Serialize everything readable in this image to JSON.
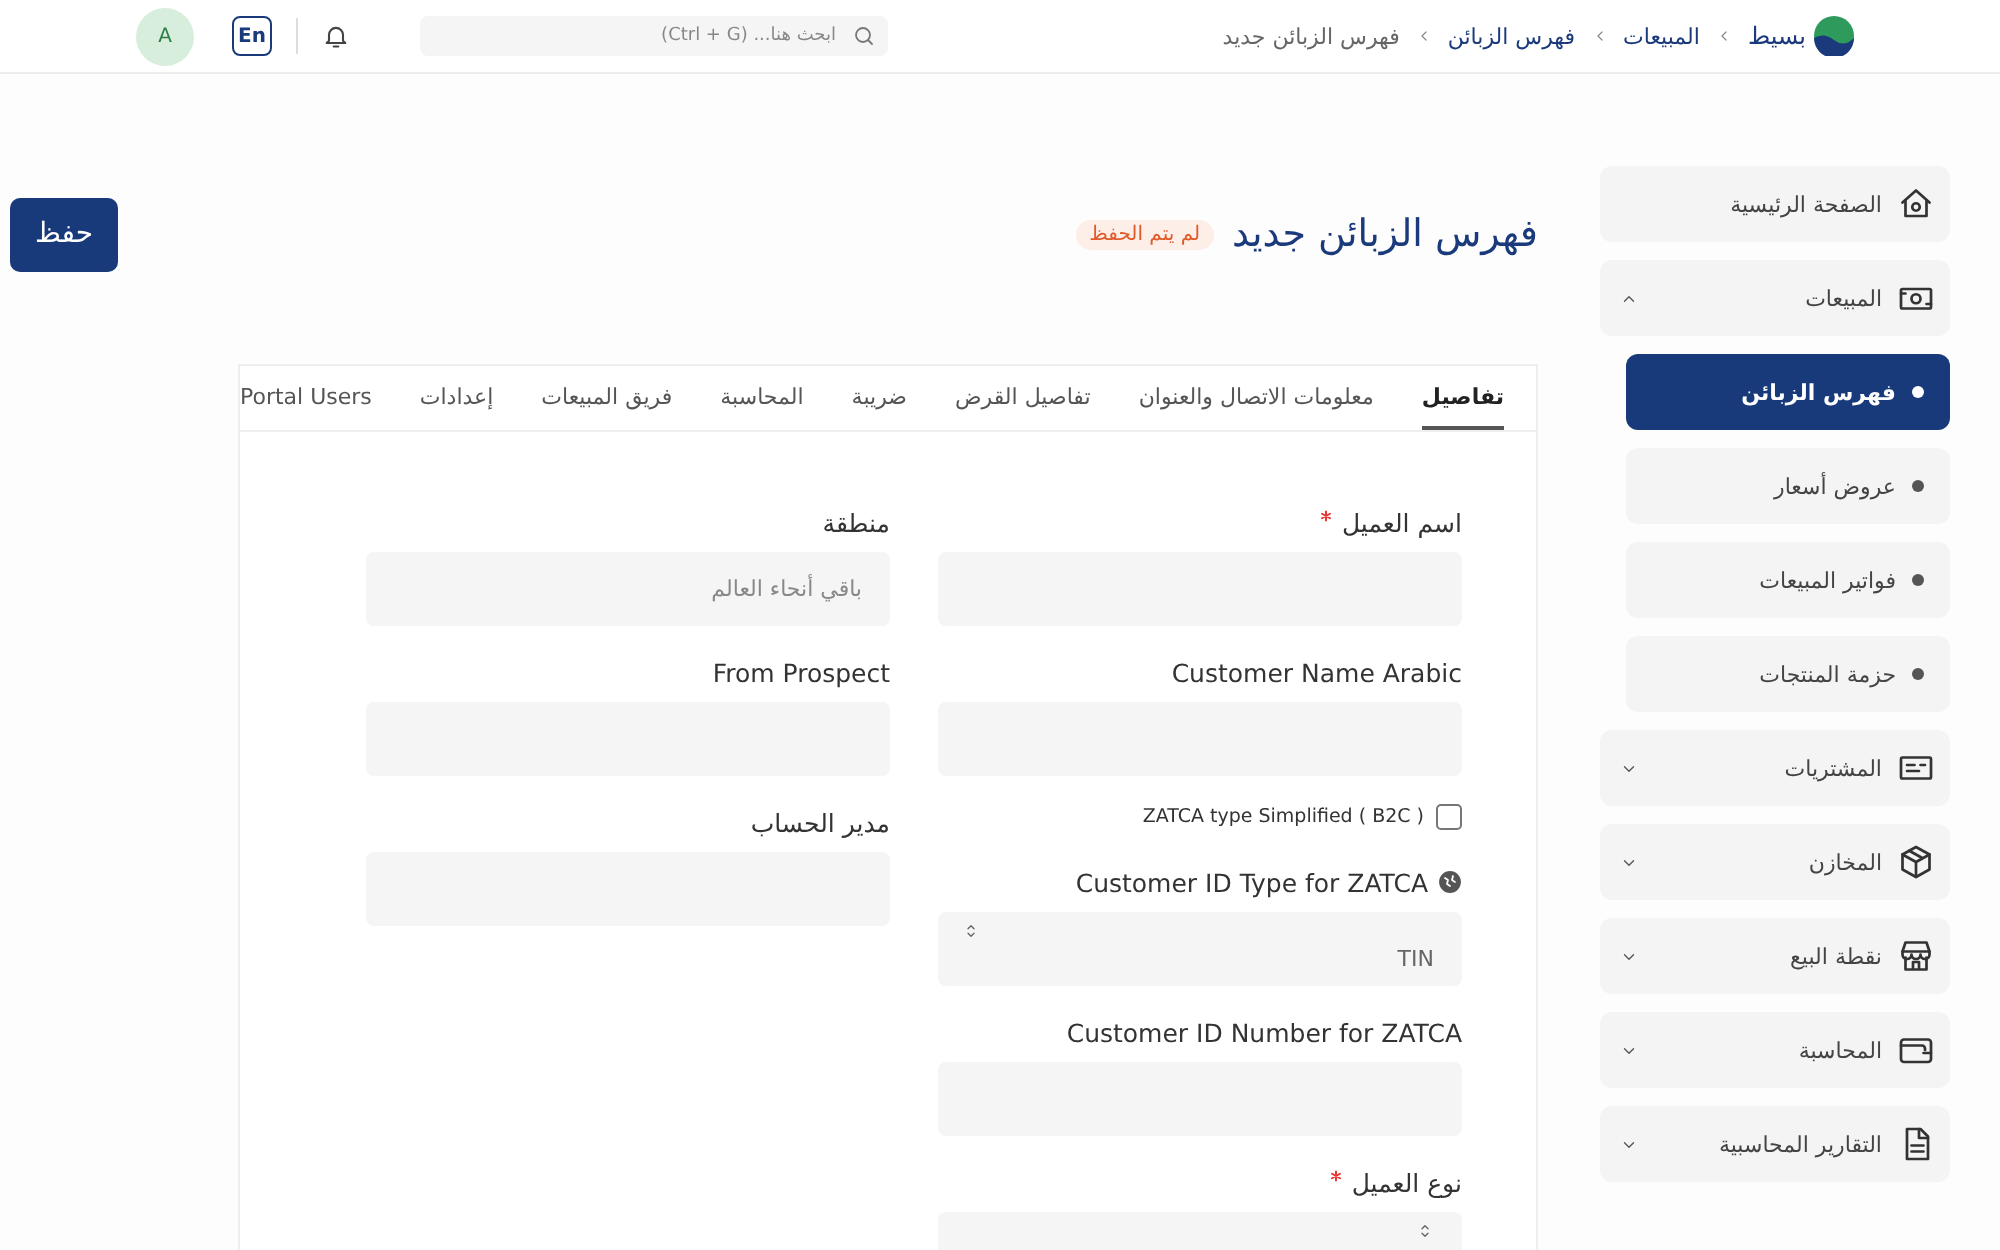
{
  "topbar": {
    "breadcrumbs": [
      {
        "label": "بسيط",
        "kind": "brand"
      },
      {
        "label": "المبيعات",
        "kind": "link"
      },
      {
        "label": "فهرس الزبائن",
        "kind": "link"
      },
      {
        "label": "فهرس الزبائن جديد",
        "kind": "current"
      }
    ],
    "search": {
      "placeholder": "ابحث هنا... (Ctrl + G)"
    },
    "language": "En",
    "avatar": "A"
  },
  "sidebar": {
    "items": [
      {
        "label": "الصفحة الرئيسية"
      },
      {
        "label": "المبيعات",
        "expanded": true,
        "children": [
          {
            "label": "فهرس الزبائن",
            "selected": true
          },
          {
            "label": "عروض أسعار",
            "selected": false
          },
          {
            "label": "فواتير المبيعات",
            "selected": false
          },
          {
            "label": "حزمة المنتجات",
            "selected": false
          }
        ]
      },
      {
        "label": "المشتريات",
        "expanded": false
      },
      {
        "label": "المخازن",
        "expanded": false
      },
      {
        "label": "نقطة البيع",
        "expanded": false
      },
      {
        "label": "المحاسبة",
        "expanded": false
      },
      {
        "label": "التقارير المحاسبية",
        "expanded": false
      }
    ]
  },
  "page": {
    "title": "فهرس الزبائن جديد",
    "status_badge": "لم يتم الحفظ",
    "save_button": "حفظ"
  },
  "tabs": [
    {
      "label": "تفاصيل",
      "selected": true
    },
    {
      "label": "معلومات الاتصال والعنوان",
      "selected": false
    },
    {
      "label": "تفاصيل القرض",
      "selected": false
    },
    {
      "label": "ضريبة",
      "selected": false
    },
    {
      "label": "المحاسبة",
      "selected": false
    },
    {
      "label": "فريق المبيعات",
      "selected": false
    },
    {
      "label": "إعدادات",
      "selected": false
    },
    {
      "label": "Portal Users",
      "selected": false
    }
  ],
  "form": {
    "columns": [
      [
        {
          "kind": "input",
          "label": "اسم العميل",
          "required": true
        },
        {
          "kind": "input",
          "label": "Customer Name Arabic"
        },
        {
          "kind": "checkbox",
          "label": "ZATCA type Simplified ( B2C )",
          "checked": false
        },
        {
          "kind": "select",
          "label": "Customer ID Type for ZATCA",
          "has_icon": true,
          "value": "TIN"
        },
        {
          "kind": "input",
          "label": "Customer ID Number for ZATCA"
        },
        {
          "kind": "select",
          "label": "نوع العميل",
          "required": true
        }
      ],
      [
        {
          "kind": "input",
          "label": "منطقة",
          "value": "باقي أنحاء العالم"
        },
        {
          "kind": "input",
          "label": "From Prospect"
        },
        {
          "kind": "input",
          "label": "مدير الحساب"
        }
      ]
    ]
  }
}
